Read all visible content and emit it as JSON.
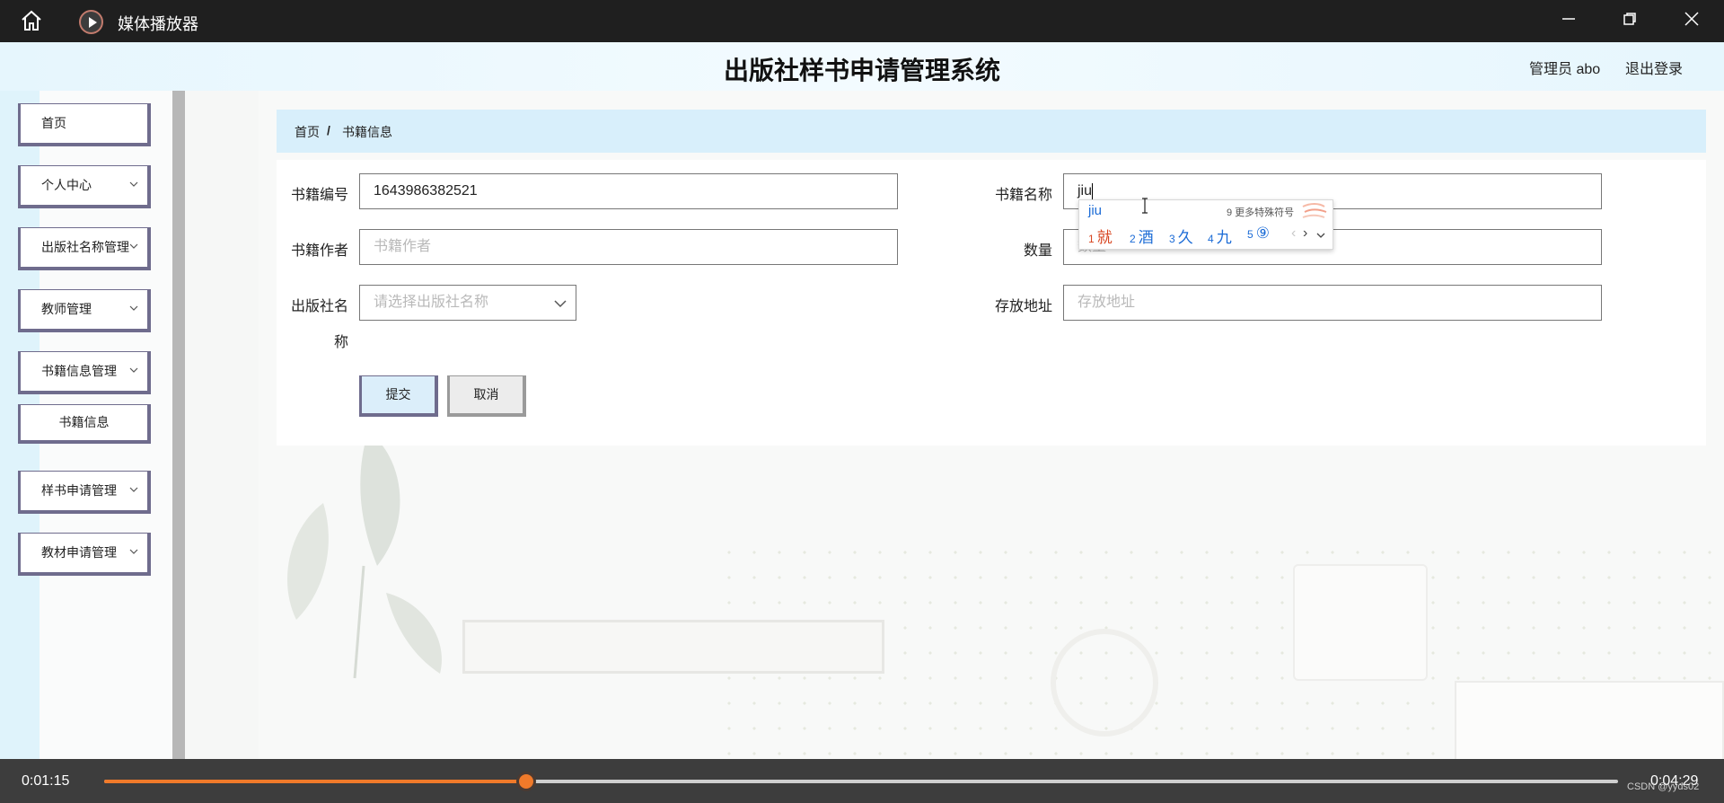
{
  "window": {
    "title": "媒体播放器"
  },
  "header": {
    "title": "出版社样书申请管理系统",
    "admin": "管理员 abo",
    "logout": "退出登录"
  },
  "sidebar": {
    "items": [
      {
        "label": "首页"
      },
      {
        "label": "个人中心"
      },
      {
        "label": "出版社名称管理"
      },
      {
        "label": "教师管理"
      },
      {
        "label": "书籍信息管理"
      },
      {
        "label": "样书申请管理"
      },
      {
        "label": "教材申请管理"
      }
    ],
    "sub_item": "书籍信息"
  },
  "breadcrumb": {
    "home": "首页",
    "separator": "/",
    "current": "书籍信息"
  },
  "form": {
    "book_no": {
      "label": "书籍编号",
      "value": "1643986382521"
    },
    "book_name": {
      "label": "书籍名称",
      "value": "jiu"
    },
    "author": {
      "label": "书籍作者",
      "placeholder": "书籍作者"
    },
    "quantity": {
      "label": "数量",
      "placeholder": "数量"
    },
    "publisher": {
      "label_line1": "出版社名",
      "label_line2": "称",
      "placeholder": "请选择出版社名称"
    },
    "location": {
      "label": "存放地址",
      "placeholder": "存放地址"
    },
    "submit": "提交",
    "cancel": "取消"
  },
  "ime": {
    "pinyin": "jiu",
    "more": "9 更多特殊符号",
    "candidates": [
      {
        "num": "1",
        "text": "就"
      },
      {
        "num": "2",
        "text": "酒"
      },
      {
        "num": "3",
        "text": "久"
      },
      {
        "num": "4",
        "text": "九"
      },
      {
        "num": "5",
        "text": "⑨"
      }
    ]
  },
  "player": {
    "current_time": "0:01:15",
    "total_time": "0:04:29",
    "progress": 0.2788,
    "watermark": "CSDN @yyds02"
  },
  "colors": {
    "accent": "#f07a2a",
    "header_bg": "#e6f6fd",
    "breadcrumb_bg": "#d8effb",
    "nav_border": "#6f6c8d"
  }
}
